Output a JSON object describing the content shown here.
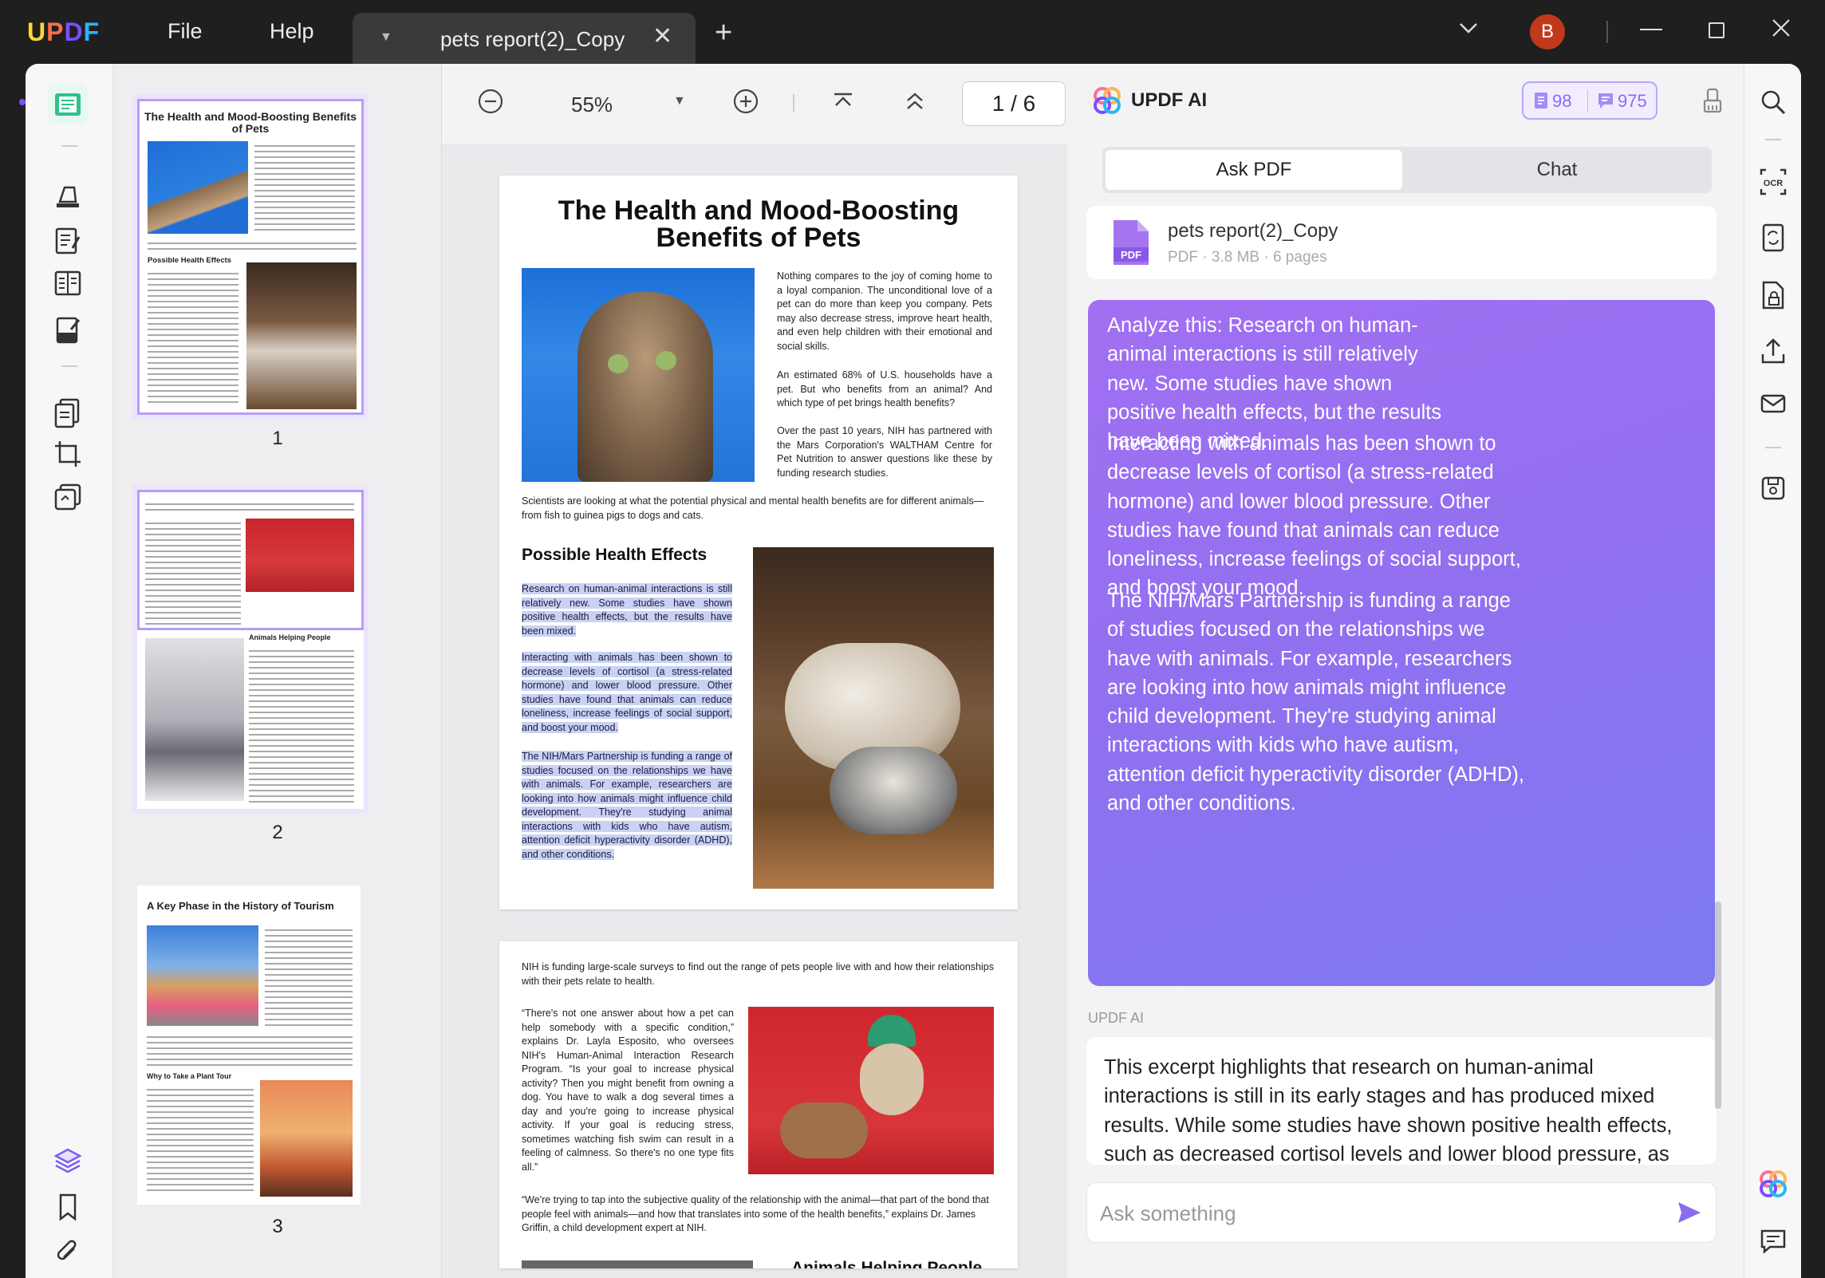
{
  "app": {
    "logo": "UPDF",
    "brand_colors": [
      "#fdd835",
      "#ff7043",
      "#7c4dff",
      "#29b6f6"
    ]
  },
  "titlebar": {
    "menu": [
      {
        "label": "File"
      },
      {
        "label": "Help"
      }
    ],
    "tab_title": "pets report(2)_Copy",
    "avatar_letter": "B",
    "avatar_color": "#c1391d"
  },
  "viewer_toolbar": {
    "zoom": "55%",
    "page_current": "1",
    "page_total": "6",
    "page_display": "1  /  6"
  },
  "thumbnails": [
    {
      "number": "1",
      "title": "The Health and Mood-Boosting Benefits of Pets",
      "subhead": "Possible Health Effects"
    },
    {
      "number": "2",
      "subhead": "Animals Helping People"
    },
    {
      "number": "3",
      "title": "A Key Phase in the History of Tourism",
      "subhead": "Why to Take a Plant Tour"
    }
  ],
  "page1": {
    "title_line1": "The Health and Mood-Boosting",
    "title_line2": "Benefits of Pets",
    "intro": [
      "Nothing compares to the joy of coming home to a loyal companion. The unconditional love of a pet can do more than keep you company. Pets may also decrease stress, improve heart health, and even help children with their emotional and social skills.",
      "An estimated 68% of U.S. households have a pet. But who benefits from an animal? And which type of pet brings health benefits?",
      "Over the past 10 years, NIH has partnered with the Mars Corporation's WALTHAM Centre for Pet Nutrition to answer questions like these by funding research studies."
    ],
    "scientists": "Scientists are looking at what the potential physical and mental health benefits are for different animals—from fish to guinea pigs to dogs and cats.",
    "section": "Possible Health Effects",
    "highlighted": [
      "Research on human-animal interactions is still relatively new. Some studies have shown positive health effects, but the results have been mixed.",
      "Interacting with animals has been shown to decrease levels of cortisol (a stress-related hormone) and lower blood pressure. Other studies have found that animals can reduce loneliness, increase feelings of social support, and boost your mood.",
      "The NIH/Mars Partnership is funding a range of studies focused on the relationships we have with animals. For example, researchers are looking into how animals might influence child development. They're studying animal interactions with kids who have autism, attention deficit hyperactivity disorder (ADHD), and other conditions."
    ]
  },
  "page2": {
    "intro": "NIH is funding large-scale surveys to find out the range of pets people live with and how their relationships with their pets relate to health.",
    "quote1": "“There's not one answer about how a pet can help somebody with a specific condition,” explains Dr. Layla Esposito, who oversees NIH's Human-Animal Interaction Research Program. “Is your goal to increase physical activity? Then you might benefit from owning a dog. You have to walk a dog several times a day and you're going to increase physical activity. If your goal is reducing stress, sometimes watching fish swim can result in a feeling of calmness. So there's no one type fits all.”",
    "quote2": "“We're trying to tap into the subjective quality of the relationship with the animal—that part of the bond that people feel with animals—and how that translates into some of the health benefits,” explains Dr. James Griffin, a child development expert at NIH.",
    "section": "Animals Helping People"
  },
  "ai_panel": {
    "title": "UPDF AI",
    "credits": {
      "docs": "98",
      "messages": "975"
    },
    "tabs": {
      "ask": "Ask PDF",
      "chat": "Chat"
    },
    "file": {
      "name": "pets report(2)_Copy",
      "meta": "PDF · 3.8 MB · 6 pages",
      "icon_label": "PDF"
    },
    "user_message": [
      "Analyze this: Research on human-animal interactions is still relatively new. Some studies have shown positive health effects, but the results have been mixed.",
      "Interacting with animals has been shown to decrease levels of cortisol (a stress-related hormone) and lower blood pressure. Other studies have found that animals can reduce loneliness, increase feelings of social support, and boost your mood.",
      "The NIH/Mars Partnership is funding a range of studies focused on the relationships we have with animals. For example, researchers are looking into how animals might influence child development. They're studying animal interactions with kids who have autism, attention deficit hyperactivity disorder (ADHD), and other conditions."
    ],
    "response_label": "UPDF AI",
    "response": "This excerpt highlights that research on human-animal interactions is still in its early stages and has produced mixed results. While some studies have shown positive health effects, such as decreased cortisol levels and lower blood pressure, as",
    "input_placeholder": "Ask something",
    "accent": "#8a6cf0"
  }
}
